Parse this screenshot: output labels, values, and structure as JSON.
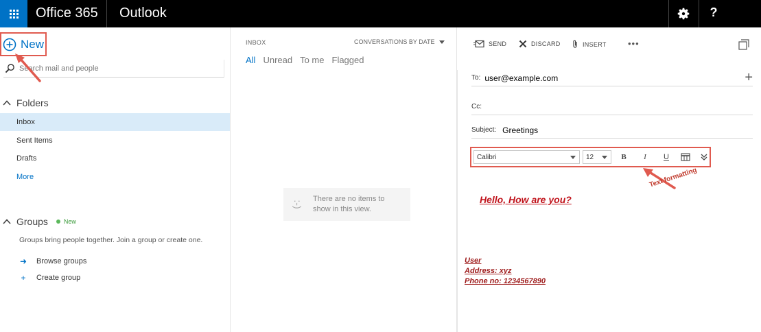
{
  "topbar": {
    "brand": "Office 365",
    "app": "Outlook",
    "colors": {
      "bar": "#000000",
      "waffle": "#0072c6"
    },
    "icons": [
      "app-launcher-icon",
      "gear-icon",
      "help-icon"
    ],
    "help_label": "?"
  },
  "leftnav": {
    "new_label": "New",
    "search_placeholder": "Search mail and people",
    "folders_heading": "Folders",
    "folders": [
      {
        "label": "Inbox",
        "selected": true
      },
      {
        "label": "Sent Items",
        "selected": false
      },
      {
        "label": "Drafts",
        "selected": false
      },
      {
        "label": "More",
        "selected": false
      }
    ],
    "groups_heading": "Groups",
    "groups_new_badge": "New",
    "groups_description": "Groups bring people together. Join a group or create one.",
    "groups_actions": [
      {
        "label": "Browse groups",
        "icon": "arrow-right-icon"
      },
      {
        "label": "Create group",
        "icon": "plus-icon"
      }
    ]
  },
  "msglist": {
    "folder_label": "INBOX",
    "sort_label": "CONVERSATIONS BY DATE",
    "filters": [
      "All",
      "Unread",
      "To me",
      "Flagged"
    ],
    "active_filter": "All",
    "empty_icon": ":-)",
    "empty_text": "There are no items to show in this view."
  },
  "compose": {
    "commands": {
      "send": "SEND",
      "discard": "DISCARD",
      "insert": "INSERT",
      "more": "•••"
    },
    "to_label": "To:",
    "to_value": "user@example.com",
    "cc_label": "Cc:",
    "cc_value": "",
    "subject_label": "Subject:",
    "subject_value": "Greetings",
    "add_recipient": "+",
    "format": {
      "font": "Calibri",
      "size": "12",
      "bold": "B",
      "italic": "I",
      "underline": "U"
    },
    "body_greeting": "Hello, How are you?",
    "signature": [
      "User",
      "Address: xyz",
      "Phone no: 1234567890"
    ]
  },
  "annotations": {
    "format_callout": "Text formatting",
    "highlight_color": "#e05a4f"
  }
}
